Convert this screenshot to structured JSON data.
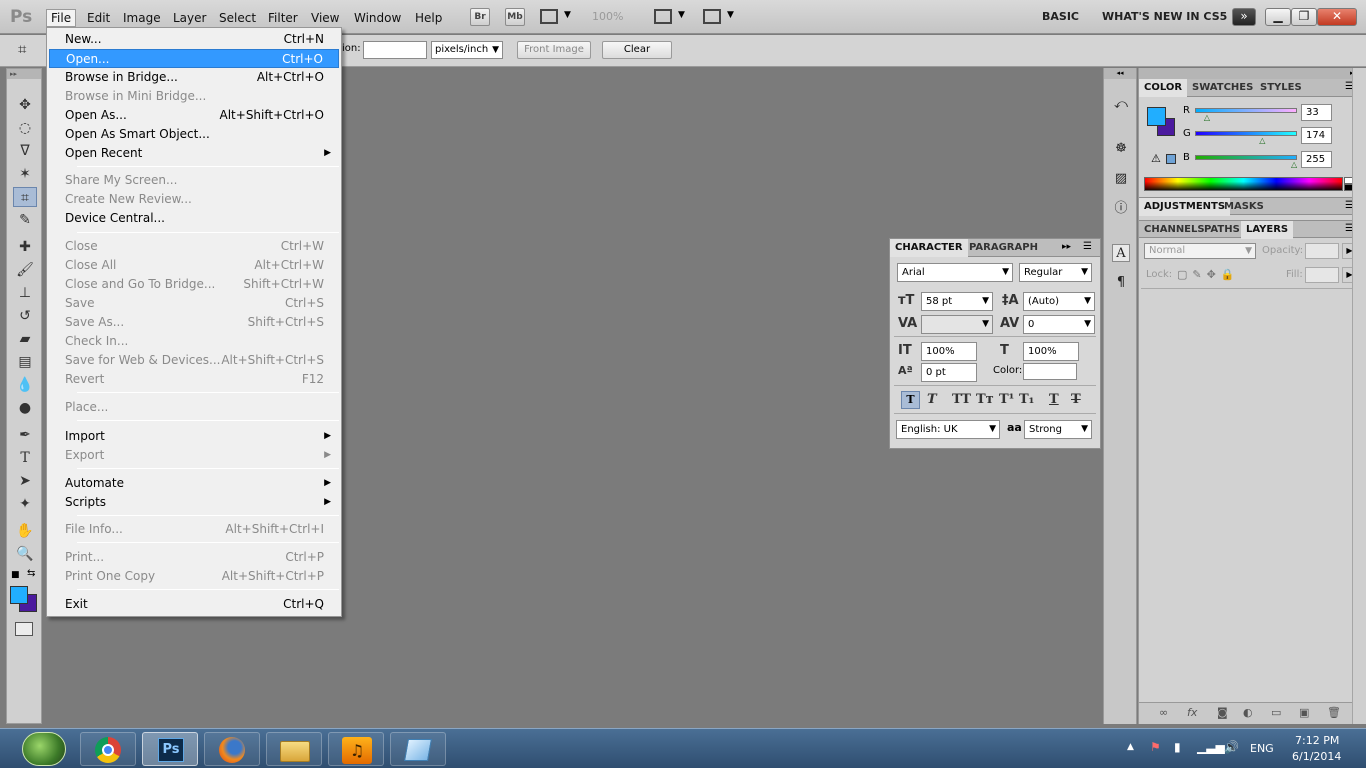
{
  "app": {
    "logo": "Ps"
  },
  "menubar": {
    "items": [
      "File",
      "Edit",
      "Image",
      "Layer",
      "Select",
      "Filter",
      "View",
      "Window",
      "Help"
    ],
    "bridge_btn": "Br",
    "minibridge_btn": "Mb",
    "zoom": "100%",
    "workspaces": [
      "BASIC",
      "WHAT'S NEW IN CS5"
    ]
  },
  "options_bar": {
    "resolution_label": "ion:",
    "resolution_value": "",
    "unit": "pixels/inch",
    "front_image": "Front Image",
    "clear": "Clear"
  },
  "file_menu": {
    "items": [
      {
        "label": "New...",
        "shortcut": "Ctrl+N",
        "disabled": false
      },
      {
        "label": "Open...",
        "shortcut": "Ctrl+O",
        "disabled": false,
        "highlighted": true
      },
      {
        "label": "Browse in Bridge...",
        "shortcut": "Alt+Ctrl+O",
        "disabled": false
      },
      {
        "label": "Browse in Mini Bridge...",
        "shortcut": "",
        "disabled": true
      },
      {
        "label": "Open As...",
        "shortcut": "Alt+Shift+Ctrl+O",
        "disabled": false
      },
      {
        "label": "Open As Smart Object...",
        "shortcut": "",
        "disabled": false
      },
      {
        "label": "Open Recent",
        "shortcut": "",
        "disabled": false,
        "submenu": true
      },
      {
        "label": "Share My Screen...",
        "shortcut": "",
        "disabled": true
      },
      {
        "label": "Create New Review...",
        "shortcut": "",
        "disabled": true
      },
      {
        "label": "Device Central...",
        "shortcut": "",
        "disabled": false
      },
      {
        "label": "Close",
        "shortcut": "Ctrl+W",
        "disabled": true
      },
      {
        "label": "Close All",
        "shortcut": "Alt+Ctrl+W",
        "disabled": true
      },
      {
        "label": "Close and Go To Bridge...",
        "shortcut": "Shift+Ctrl+W",
        "disabled": true
      },
      {
        "label": "Save",
        "shortcut": "Ctrl+S",
        "disabled": true
      },
      {
        "label": "Save As...",
        "shortcut": "Shift+Ctrl+S",
        "disabled": true
      },
      {
        "label": "Check In...",
        "shortcut": "",
        "disabled": true
      },
      {
        "label": "Save for Web & Devices...",
        "shortcut": "Alt+Shift+Ctrl+S",
        "disabled": true
      },
      {
        "label": "Revert",
        "shortcut": "F12",
        "disabled": true
      },
      {
        "label": "Place...",
        "shortcut": "",
        "disabled": true
      },
      {
        "label": "Import",
        "shortcut": "",
        "disabled": false,
        "submenu": true
      },
      {
        "label": "Export",
        "shortcut": "",
        "disabled": true,
        "submenu": true
      },
      {
        "label": "Automate",
        "shortcut": "",
        "disabled": false,
        "submenu": true
      },
      {
        "label": "Scripts",
        "shortcut": "",
        "disabled": false,
        "submenu": true
      },
      {
        "label": "File Info...",
        "shortcut": "Alt+Shift+Ctrl+I",
        "disabled": true
      },
      {
        "label": "Print...",
        "shortcut": "Ctrl+P",
        "disabled": true
      },
      {
        "label": "Print One Copy",
        "shortcut": "Alt+Shift+Ctrl+P",
        "disabled": true
      },
      {
        "label": "Exit",
        "shortcut": "Ctrl+Q",
        "disabled": false
      }
    ]
  },
  "character_panel": {
    "tabs": [
      "CHARACTER",
      "PARAGRAPH"
    ],
    "font_family": "Arial",
    "font_style": "Regular",
    "font_size": "58 pt",
    "leading": "(Auto)",
    "kerning": "",
    "tracking": "0",
    "vertical_scale": "100%",
    "horizontal_scale": "100%",
    "baseline_shift": "0 pt",
    "color_label": "Color:",
    "language": "English: UK",
    "antialias_icon": "aa",
    "antialias": "Strong"
  },
  "color_panel": {
    "tabs": [
      "COLOR",
      "SWATCHES",
      "STYLES"
    ],
    "r_label": "R",
    "g_label": "G",
    "b_label": "B",
    "r": "33",
    "g": "174",
    "b": "255",
    "r_level": 0.129,
    "g_level": 0.682,
    "b_level": 1.0,
    "foreground": "#21aeff",
    "background": "#4b1a9e"
  },
  "adjust_panel": {
    "tabs": [
      "ADJUSTMENTS",
      "MASKS"
    ]
  },
  "layers_panel": {
    "tabs": [
      "CHANNELS",
      "PATHS",
      "LAYERS"
    ],
    "blend_mode": "Normal",
    "opacity_label": "Opacity:",
    "lock_label": "Lock:",
    "fill_label": "Fill:"
  },
  "taskbar": {
    "ps_label": "Ps",
    "language": "ENG",
    "time": "7:12 PM",
    "date": "6/1/2014"
  }
}
